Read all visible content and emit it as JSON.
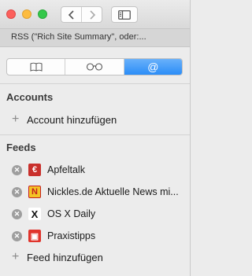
{
  "window": {
    "tab_title": "RSS (\"Rich Site Summary\", oder:..."
  },
  "toolbar": {
    "back_icon": "chevron-left-icon",
    "forward_icon": "chevron-right-icon",
    "sidebar_icon": "sidebar-icon"
  },
  "segments": [
    {
      "icon": "book-icon",
      "glyph": "📖",
      "active": false
    },
    {
      "icon": "glasses-icon",
      "glyph": "👓",
      "active": false
    },
    {
      "icon": "at-icon",
      "glyph": "@",
      "active": true
    }
  ],
  "accounts": {
    "title": "Accounts",
    "add_label": "Account hinzufügen"
  },
  "feeds": {
    "title": "Feeds",
    "items": [
      {
        "name": "Apfeltalk",
        "icon": "apfeltalk-favicon"
      },
      {
        "name": "Nickles.de Aktuelle News mi...",
        "icon": "nickles-favicon"
      },
      {
        "name": "OS X Daily",
        "icon": "osxdaily-favicon"
      },
      {
        "name": "Praxistipps",
        "icon": "praxistipps-favicon"
      }
    ],
    "add_label": "Feed hinzufügen"
  },
  "colors": {
    "accent": "#2b8df7",
    "close": "#fc605c",
    "minimize": "#fdbc40",
    "maximize": "#34c84a"
  }
}
